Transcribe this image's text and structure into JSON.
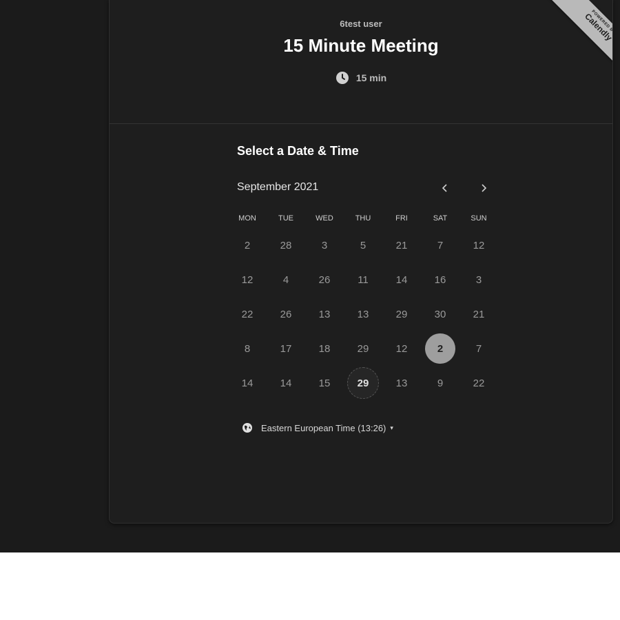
{
  "event": {
    "host": "6test user",
    "title": "15 Minute Meeting",
    "duration": "15 min"
  },
  "ribbon": {
    "small_text": "POWERED BY",
    "brand": "Calendly"
  },
  "calendar": {
    "section_title": "Select a Date & Time",
    "month_label": "September 2021",
    "prev_icon": "chevron-left-icon",
    "next_icon": "chevron-right-icon",
    "weekdays": [
      "MON",
      "TUE",
      "WED",
      "THU",
      "FRI",
      "SAT",
      "SUN"
    ],
    "weeks": [
      [
        "2",
        "28",
        "3",
        "5",
        "21",
        "7",
        "12"
      ],
      [
        "12",
        "4",
        "26",
        "11",
        "14",
        "16",
        "3"
      ],
      [
        "22",
        "26",
        "13",
        "13",
        "29",
        "30",
        "21"
      ],
      [
        "8",
        "17",
        "18",
        "29",
        "12",
        "2",
        "7"
      ],
      [
        "14",
        "14",
        "15",
        "29",
        "13",
        "9",
        "22"
      ]
    ],
    "selected_day": "2",
    "today": "29"
  },
  "timezone": {
    "label": "Eastern European Time (13:26)",
    "icon": "globe-icon",
    "caret": "▾"
  },
  "colors": {
    "page_bg": "#1b1b1b",
    "card_bg": "#1e1e1e",
    "selected": "#9e9e9e",
    "ribbon": "#b9b9b9"
  }
}
